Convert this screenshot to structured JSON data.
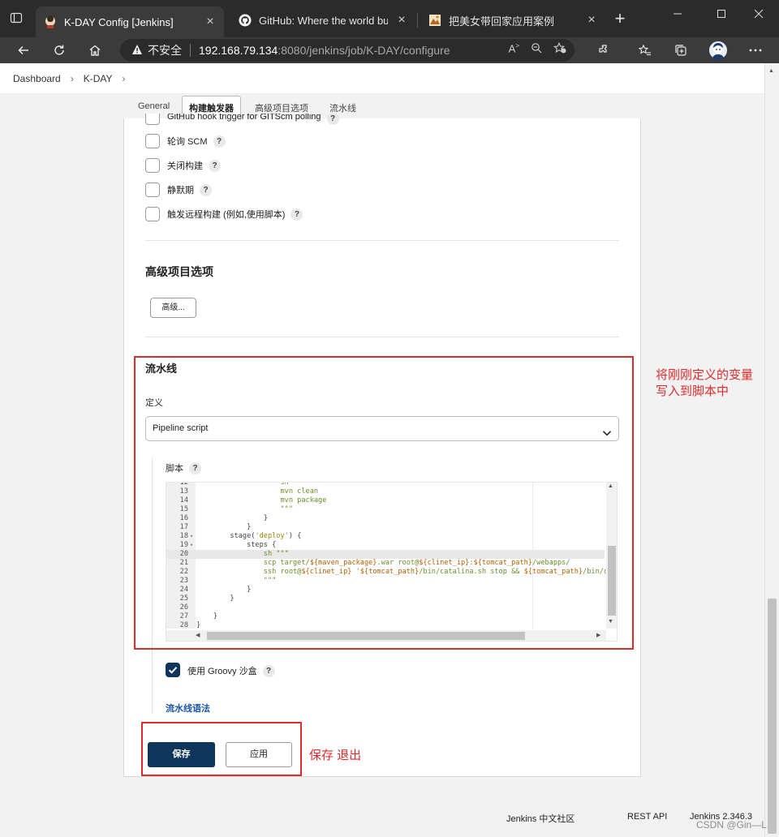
{
  "browser": {
    "tabs": [
      {
        "title": "K-DAY Config [Jenkins]",
        "active": true
      },
      {
        "title": "GitHub: Where the world builds",
        "active": false
      },
      {
        "title": "把美女带回家应用案例",
        "active": false
      }
    ],
    "address": {
      "security_label": "不安全",
      "host": "192.168.79.134",
      "path": ":8080/jenkins/job/K-DAY/configure"
    }
  },
  "breadcrumb": [
    "Dashboard",
    "K-DAY"
  ],
  "config_tabs": [
    "General",
    "构建触发器",
    "高级项目选项",
    "流水线"
  ],
  "triggers": {
    "partial_item": "GitHub hook trigger for GITScm polling",
    "items": [
      "轮询 SCM",
      "关闭构建",
      "静默期",
      "触发远程构建 (例如,使用脚本)"
    ]
  },
  "advanced": {
    "title": "高级项目选项",
    "button": "高级..."
  },
  "pipeline": {
    "title": "流水线",
    "definition_label": "定义",
    "definition_value": "Pipeline script",
    "script_label": "脚本",
    "code_lines": [
      {
        "n": "12",
        "text": "                    sh"
      },
      {
        "n": "13",
        "text": "                    mvn clean"
      },
      {
        "n": "14",
        "text": "                    mvn package"
      },
      {
        "n": "15",
        "text": "                    \"\"\""
      },
      {
        "n": "16",
        "text": "                }"
      },
      {
        "n": "17",
        "text": "            }"
      },
      {
        "n": "18",
        "text": "        stage('deploy') {"
      },
      {
        "n": "19",
        "text": "            steps {"
      },
      {
        "n": "20",
        "text": "                sh \"\"\""
      },
      {
        "n": "21",
        "text": "                scp target/${maven_package}.war root@${clinet_ip}:${tomcat_path}/webapps/"
      },
      {
        "n": "22",
        "text": "                ssh root@${clinet_ip} '${tomcat_path}/bin/catalina.sh stop && ${tomcat_path}/bin/cata"
      },
      {
        "n": "23",
        "text": "                \"\"\""
      },
      {
        "n": "24",
        "text": "            }"
      },
      {
        "n": "25",
        "text": "        }"
      },
      {
        "n": "26",
        "text": ""
      },
      {
        "n": "27",
        "text": "    }"
      },
      {
        "n": "28",
        "text": "}"
      }
    ],
    "groovy_sandbox_label": "使用 Groovy 沙盒",
    "syntax_link": "流水线语法"
  },
  "actions": {
    "save": "保存",
    "apply": "应用"
  },
  "annotations": {
    "pipeline_note": "将刚刚定义的变量\n写入到脚本中",
    "save_note": "保存 退出"
  },
  "footer": {
    "community": "Jenkins 中文社区",
    "rest_api": "REST API",
    "version": "Jenkins 2.346.3"
  },
  "watermark": "CSDN @Gin—L",
  "colors": {
    "accent": "#10355c",
    "annotation": "#e02b2b",
    "link": "#1a56a8"
  }
}
